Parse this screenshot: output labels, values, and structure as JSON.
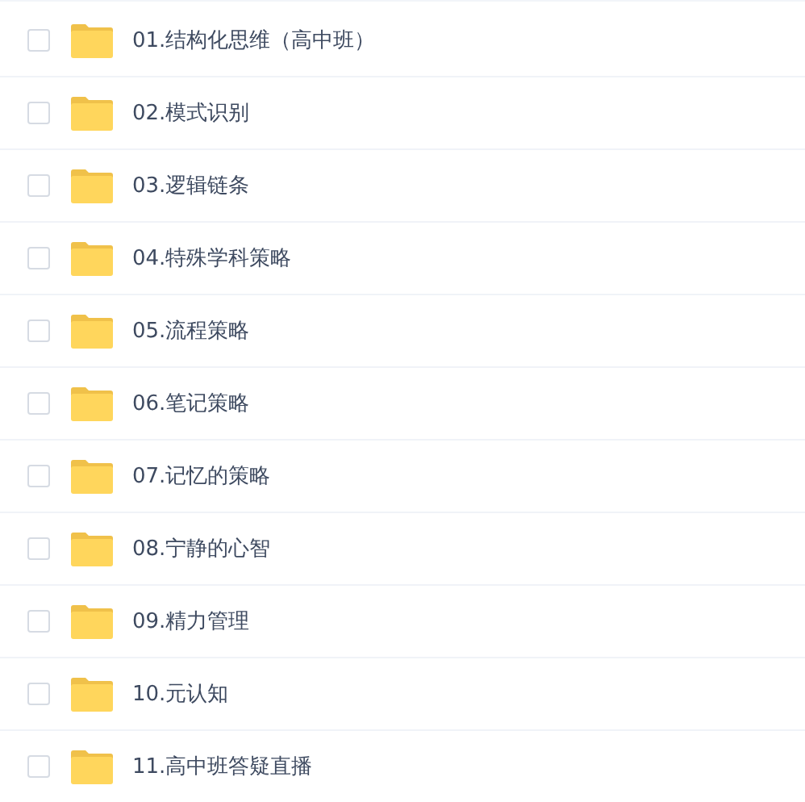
{
  "files": [
    {
      "name": "01.结构化思维（高中班）",
      "checked": false
    },
    {
      "name": "02.模式识别",
      "checked": false
    },
    {
      "name": "03.逻辑链条",
      "checked": false
    },
    {
      "name": "04.特殊学科策略",
      "checked": false
    },
    {
      "name": "05.流程策略",
      "checked": false
    },
    {
      "name": "06.笔记策略",
      "checked": false
    },
    {
      "name": "07.记忆的策略",
      "checked": false
    },
    {
      "name": "08.宁静的心智",
      "checked": false
    },
    {
      "name": "09.精力管理",
      "checked": false
    },
    {
      "name": "10.元认知",
      "checked": false
    },
    {
      "name": "11.高中班答疑直播",
      "checked": false
    }
  ]
}
